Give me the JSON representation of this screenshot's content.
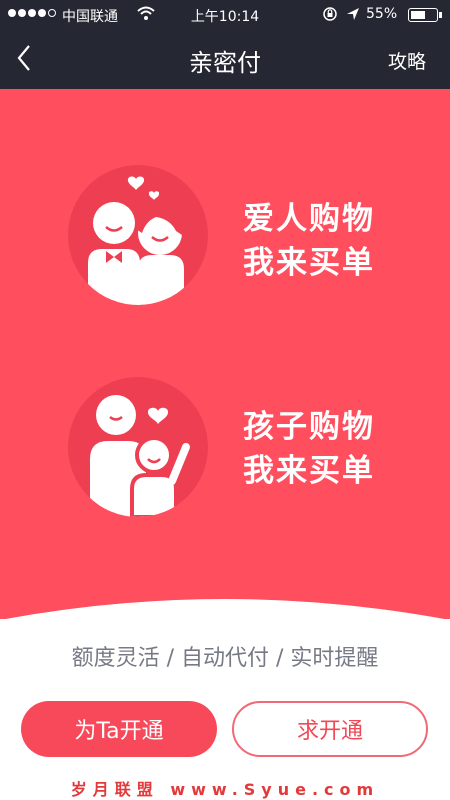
{
  "status_bar": {
    "carrier": "中国联通",
    "time": "上午10:14",
    "battery_percent": "55%",
    "battery_level": 0.55,
    "signal_bars_filled": 4,
    "signal_bars_total": 5
  },
  "nav": {
    "back_icon": "chevron-left-icon",
    "title": "亲密付",
    "guide_label": "攻略"
  },
  "hero": {
    "items": [
      {
        "line1": "爱人购物",
        "line2": "我来买单",
        "icon": "couple-icon"
      },
      {
        "line1": "孩子购物",
        "line2": "我来买单",
        "icon": "parent-child-icon"
      }
    ]
  },
  "features_text": "额度灵活 / 自动代付 / 实时提醒",
  "buttons": {
    "primary_label": "为Ta开通",
    "secondary_label": "求开通"
  },
  "watermark": "岁月联盟 www.Syue.com",
  "colors": {
    "header_bg": "#252833",
    "hero_bg": "#ff4e5e",
    "circle_bg": "#ee3f52",
    "accent": "#f8495b",
    "feature_text": "#777a85"
  }
}
